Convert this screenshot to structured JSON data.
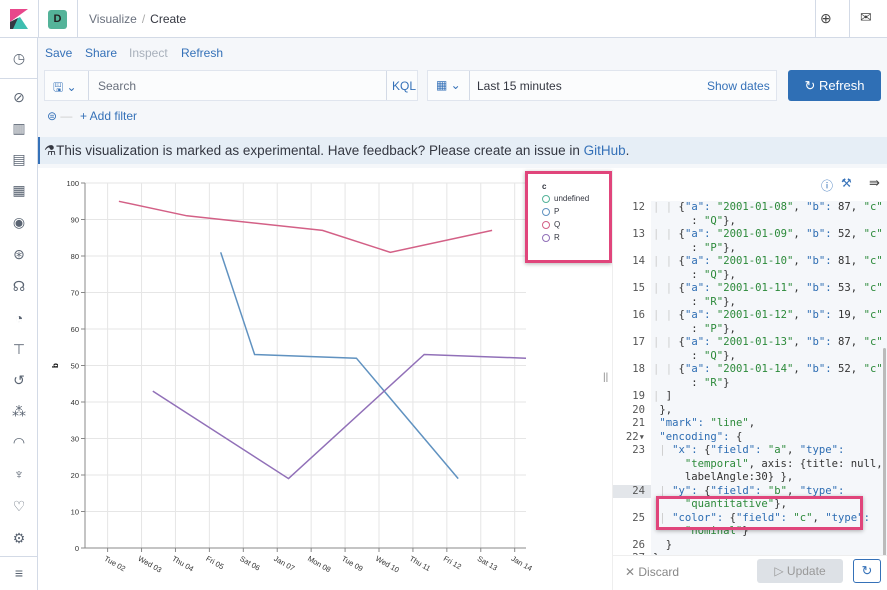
{
  "header": {
    "space_initial": "D",
    "breadcrumbs": [
      "Visualize",
      "Create"
    ]
  },
  "sidebar": {
    "items": [
      "clock-icon",
      "compass-icon",
      "visualize-icon",
      "dashboard-icon",
      "canvas-icon",
      "maps-icon",
      "ml-icon",
      "infrastructure-icon",
      "logs-icon",
      "apm-icon",
      "uptime-icon",
      "siem-icon",
      "monitoring-icon",
      "dev-tools-icon",
      "heartbeat-icon",
      "gear-icon",
      "collapse-icon"
    ]
  },
  "top_menu": {
    "save": "Save",
    "share": "Share",
    "inspect": "Inspect",
    "refresh": "Refresh"
  },
  "query": {
    "placeholder": "Search",
    "language": "KQL",
    "time_range": "Last 15 minutes",
    "show_dates": "Show dates",
    "refresh_button": "Refresh",
    "add_filter": "+ Add filter"
  },
  "callout": {
    "text": "This visualization is marked as experimental. Have feedback? Please create an issue in ",
    "link": "GitHub",
    "end": "."
  },
  "colors": {
    "accent": "#3571b8",
    "highlight": "#e0457b",
    "undefined": "#54b399",
    "P": "#6092c0",
    "Q": "#d36086",
    "R": "#9170b8"
  },
  "chart_data": {
    "type": "line",
    "ylabel": "b",
    "ylim": [
      0,
      100
    ],
    "yticks": [
      0,
      10,
      20,
      30,
      40,
      50,
      60,
      70,
      80,
      90,
      100
    ],
    "xtick_labels": [
      "Tue 02",
      "Wed 03",
      "Thu 04",
      "Fri 05",
      "Sat 06",
      "Jan 07",
      "Mon 08",
      "Tue 09",
      "Wed 10",
      "Thu 11",
      "Fri 12",
      "Sat 13",
      "Jan 14"
    ],
    "xlim": [
      "2001-01-01",
      "2001-01-14"
    ],
    "grid": true,
    "legend": {
      "title": "c",
      "position": "top-right",
      "entries": [
        "undefined",
        "P",
        "Q",
        "R"
      ]
    },
    "series": [
      {
        "name": "P",
        "points": [
          [
            "2001-01-05",
            81
          ],
          [
            "2001-01-06",
            53
          ],
          [
            "2001-01-09",
            52
          ],
          [
            "2001-01-12",
            19
          ]
        ]
      },
      {
        "name": "Q",
        "points": [
          [
            "2001-01-02",
            95
          ],
          [
            "2001-01-04",
            91
          ],
          [
            "2001-01-08",
            87
          ],
          [
            "2001-01-10",
            81
          ],
          [
            "2001-01-13",
            87
          ]
        ]
      },
      {
        "name": "R",
        "points": [
          [
            "2001-01-03",
            43
          ],
          [
            "2001-01-07",
            19
          ],
          [
            "2001-01-11",
            53
          ],
          [
            "2001-01-14",
            52
          ]
        ]
      }
    ]
  },
  "editor": {
    "rows": [
      {
        "n": "12",
        "t": "| | {\"a\": \"2001-01-08\", \"b\": 87, \"c\""
      },
      {
        "n": "",
        "t": "      : \"Q\"},"
      },
      {
        "n": "13",
        "t": "| | {\"a\": \"2001-01-09\", \"b\": 52, \"c\""
      },
      {
        "n": "",
        "t": "      : \"P\"},"
      },
      {
        "n": "14",
        "t": "| | {\"a\": \"2001-01-10\", \"b\": 81, \"c\""
      },
      {
        "n": "",
        "t": "      : \"Q\"},"
      },
      {
        "n": "15",
        "t": "| | {\"a\": \"2001-01-11\", \"b\": 53, \"c\""
      },
      {
        "n": "",
        "t": "      : \"R\"},"
      },
      {
        "n": "16",
        "t": "| | {\"a\": \"2001-01-12\", \"b\": 19, \"c\""
      },
      {
        "n": "",
        "t": "      : \"P\"},"
      },
      {
        "n": "17",
        "t": "| | {\"a\": \"2001-01-13\", \"b\": 87, \"c\""
      },
      {
        "n": "",
        "t": "      : \"Q\"},"
      },
      {
        "n": "18",
        "t": "| | {\"a\": \"2001-01-14\", \"b\": 52, \"c\""
      },
      {
        "n": "",
        "t": "      : \"R\"}"
      },
      {
        "n": "19",
        "t": "| ]"
      },
      {
        "n": "20",
        "t": " },"
      },
      {
        "n": "21",
        "t": " \"mark\": \"line\","
      },
      {
        "n": "22▾",
        "t": " \"encoding\": {"
      },
      {
        "n": "23",
        "t": " | \"x\": {\"field\": \"a\", \"type\":"
      },
      {
        "n": "",
        "t": "     \"temporal\", axis: {title: null,"
      },
      {
        "n": "",
        "t": "     labelAngle:30} },"
      },
      {
        "n": "24",
        "t": " | \"y\": {\"field\": \"b\", \"type\":"
      },
      {
        "n": "",
        "t": "     \"quantitative\"},"
      },
      {
        "n": "25",
        "t": " | \"color\": {\"field\": \"c\", \"type\":"
      },
      {
        "n": "",
        "t": "     \"nominal\"}"
      },
      {
        "n": "26",
        "t": "  }"
      },
      {
        "n": "27",
        "t": "}"
      }
    ],
    "discard": "Discard",
    "update": "Update"
  }
}
